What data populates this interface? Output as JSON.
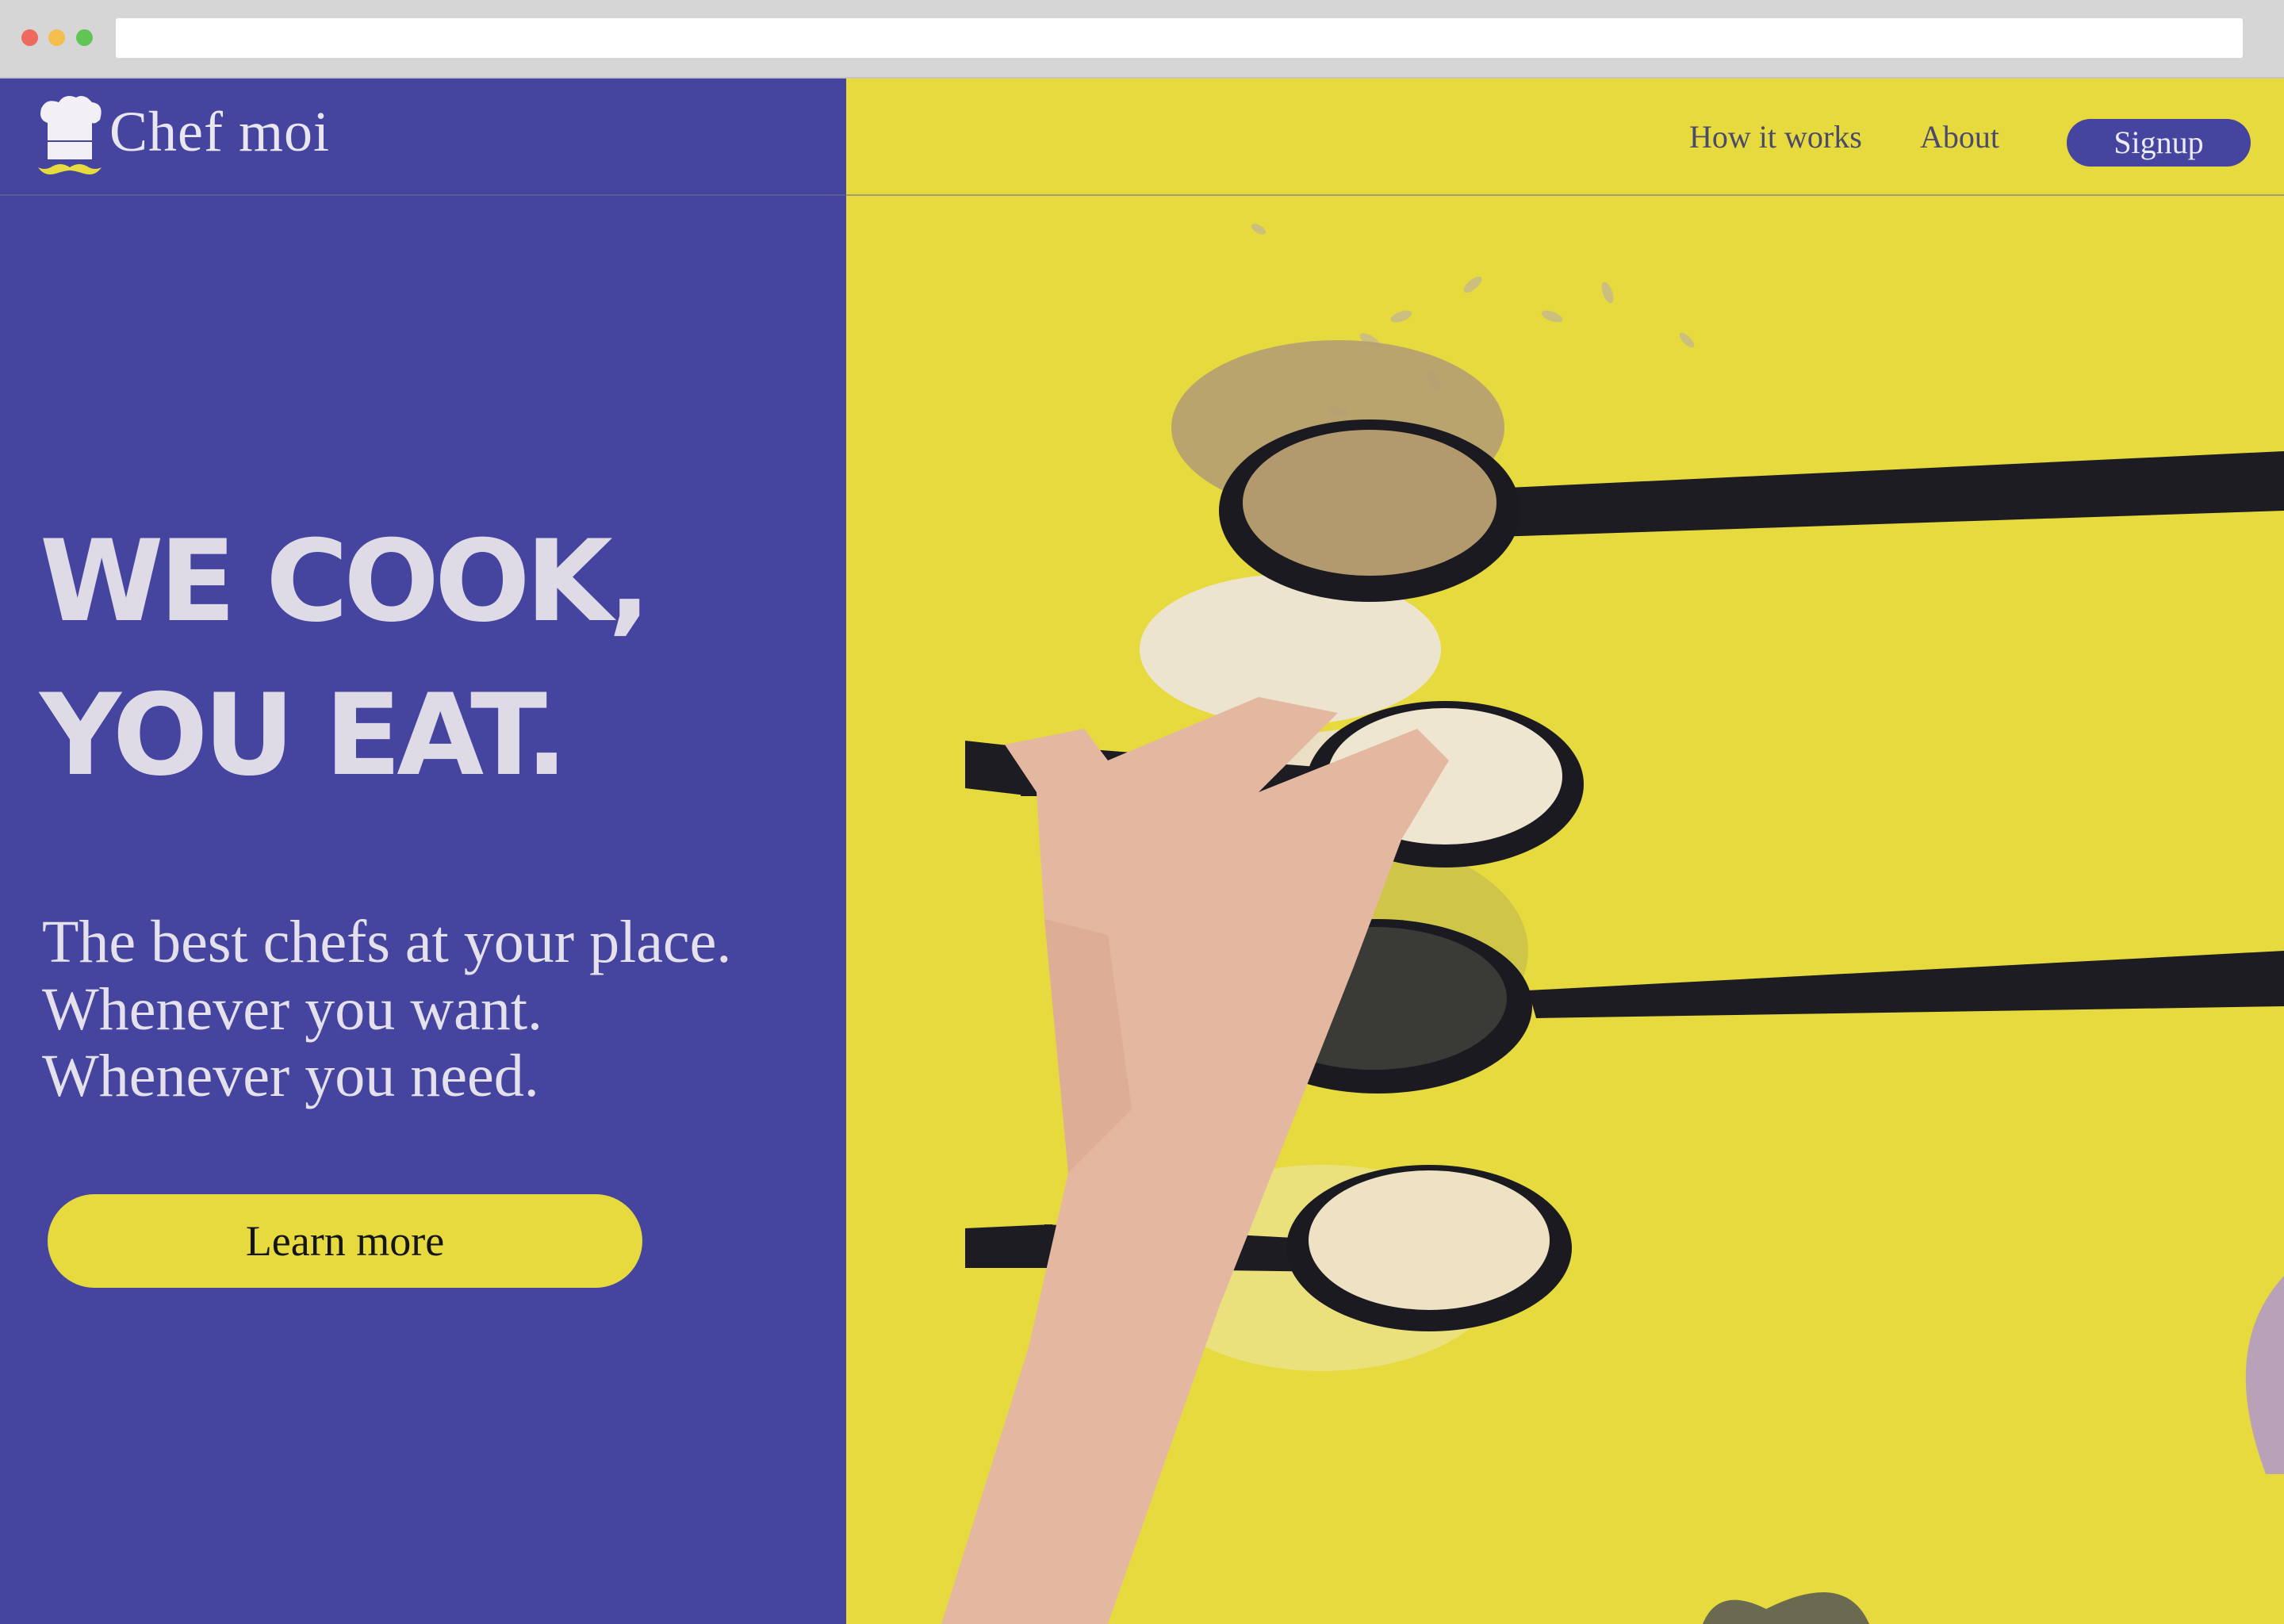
{
  "brand": {
    "name": "Chef moi"
  },
  "nav": {
    "how_it_works": "How it works",
    "about": "About",
    "signup": "Signup"
  },
  "hero": {
    "headline_line1": "WE COOK,",
    "headline_line2": "YOU EAT.",
    "subline1": "The best chefs at your place.",
    "subline2": "Whenever you want.",
    "subline3": "Whenever you need.",
    "cta": "Learn more"
  },
  "colors": {
    "primary": "#45449e",
    "accent": "#e6da3e",
    "chrome": "#d6d6d6"
  },
  "icons": {
    "logo": "chef-hat-mustache-icon"
  }
}
